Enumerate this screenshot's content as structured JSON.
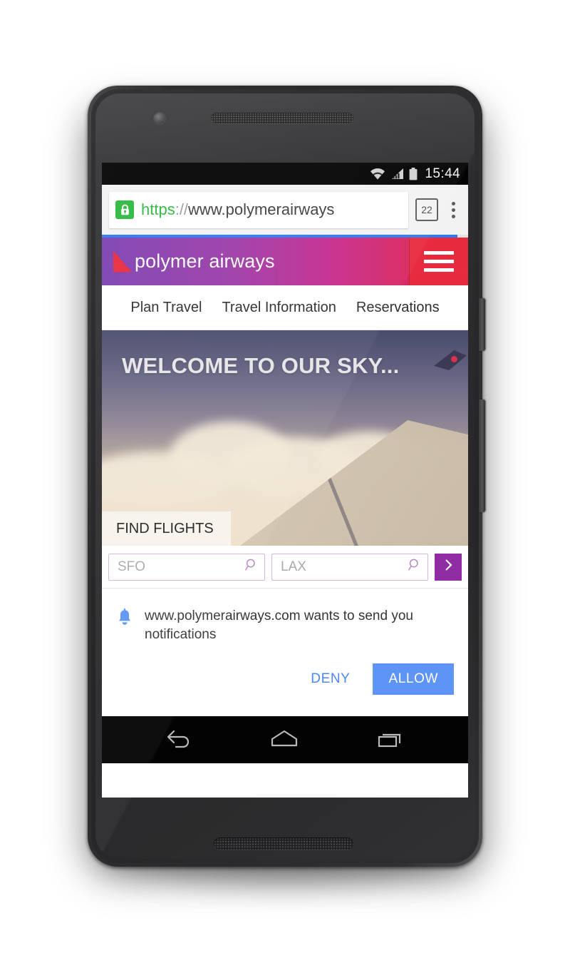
{
  "device": {
    "type": "android-phone",
    "front_camera": "front-camera",
    "earpiece": "earpiece-speaker",
    "bottom_speaker": "bottom-speaker",
    "power_button": "power-button",
    "volume_button": "volume-rocker"
  },
  "status_bar": {
    "clock": "15:44",
    "icons": [
      "wifi-icon",
      "cellular-signal-icon",
      "battery-icon"
    ]
  },
  "browser": {
    "security_icon": "lock-icon",
    "url_scheme": "https",
    "url_separator": "://",
    "url_host": "www.polymerairways",
    "url_full": "https://www.polymerairways",
    "tab_count": "22",
    "overflow_menu": "kebab-menu-icon",
    "loading_progress_percent": 97,
    "progress_color": "#2979f2"
  },
  "site": {
    "brand_name": "polymer airways",
    "brand_mark": "triangle-logo",
    "menu_icon": "hamburger-icon",
    "header_gradient_start": "#7b3fb0",
    "header_gradient_end": "#e01f3d",
    "menu_button_color": "#e8283c",
    "nav_items": [
      {
        "label": "Plan Travel"
      },
      {
        "label": "Travel Information"
      },
      {
        "label": "Reservations"
      }
    ],
    "hero": {
      "title": "WELCOME TO OUR SKY...",
      "tab_label": "FIND FLIGHTS"
    },
    "search": {
      "origin_placeholder": "SFO",
      "origin_value": "",
      "destination_placeholder": "LAX",
      "destination_value": "",
      "search_icon": "magnifier-icon",
      "submit_icon": "chevron-right-icon",
      "submit_color": "#8e2aa0",
      "field_border_color": "#d9b4dc"
    }
  },
  "permission_dialog": {
    "icon": "bell-icon",
    "message": "www.polymerairways.com wants to send you notifications",
    "deny_label": "DENY",
    "allow_label": "ALLOW",
    "deny_color": "#4a86f7",
    "allow_color": "#5b93f5"
  },
  "android_nav": {
    "back": "back-icon",
    "home": "home-icon",
    "recents": "recents-icon"
  }
}
